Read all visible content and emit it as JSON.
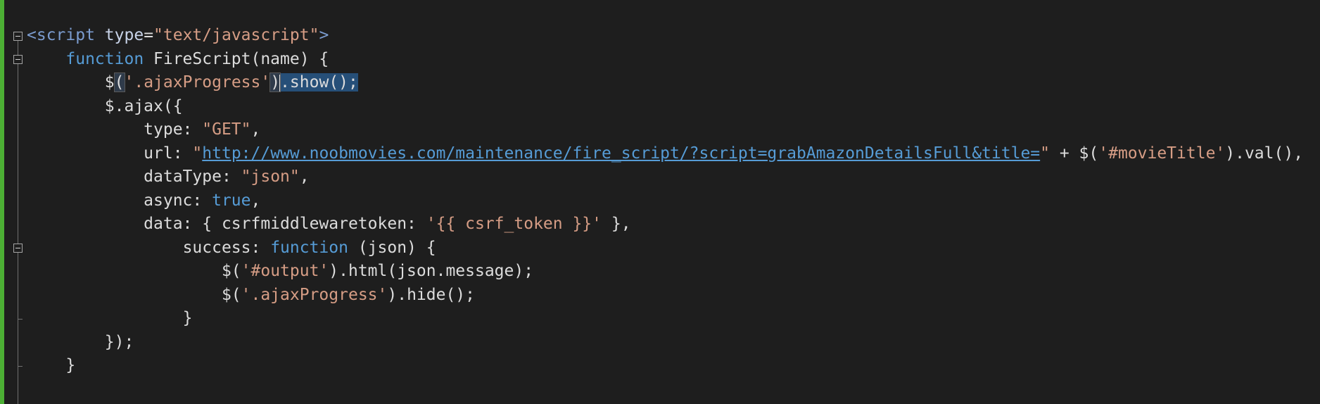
{
  "colors": {
    "background": "#1e1e1e",
    "change_bar": "#4caf34",
    "keyword": "#569cd6",
    "string": "#d69d85",
    "plain": "#dcdcdc",
    "selection": "#264f78"
  },
  "editor": {
    "lines": [
      {
        "indent": 0,
        "tokens": [
          {
            "c": "tag",
            "t": "<script"
          },
          {
            "c": "attr",
            "t": " type"
          },
          {
            "c": "plain",
            "t": "="
          },
          {
            "c": "string",
            "t": "\"text/javascript\""
          },
          {
            "c": "tag",
            "t": ">"
          }
        ]
      },
      {
        "indent": 4,
        "tokens": [
          {
            "c": "keyword",
            "t": "function"
          },
          {
            "c": "plain",
            "t": " FireScript(name) {"
          }
        ]
      },
      {
        "indent": 8,
        "tokens": [
          {
            "c": "plain",
            "t": "$"
          },
          {
            "c": "hl",
            "t": "("
          },
          {
            "c": "string",
            "t": "'.ajaxProgress'"
          },
          {
            "c": "hl",
            "t": ")"
          },
          {
            "c": "caret",
            "t": ""
          },
          {
            "c": "sel",
            "t": ".show();"
          }
        ]
      },
      {
        "indent": 8,
        "tokens": [
          {
            "c": "plain",
            "t": "$.ajax({"
          }
        ]
      },
      {
        "indent": 12,
        "tokens": [
          {
            "c": "plain",
            "t": "type: "
          },
          {
            "c": "string",
            "t": "\"GET\""
          },
          {
            "c": "plain",
            "t": ","
          }
        ]
      },
      {
        "indent": 12,
        "tokens": [
          {
            "c": "plain",
            "t": "url: "
          },
          {
            "c": "string",
            "t": "\""
          },
          {
            "c": "url",
            "t": "http://www.noobmovies.com/maintenance/fire_script/?script=grabAmazonDetailsFull&title="
          },
          {
            "c": "string",
            "t": "\""
          },
          {
            "c": "plain",
            "t": " + $("
          },
          {
            "c": "string",
            "t": "'#movieTitle'"
          },
          {
            "c": "plain",
            "t": ").val(),"
          }
        ]
      },
      {
        "indent": 12,
        "tokens": [
          {
            "c": "plain",
            "t": "dataType: "
          },
          {
            "c": "string",
            "t": "\"json\""
          },
          {
            "c": "plain",
            "t": ","
          }
        ]
      },
      {
        "indent": 12,
        "tokens": [
          {
            "c": "plain",
            "t": "async: "
          },
          {
            "c": "keyword",
            "t": "true"
          },
          {
            "c": "plain",
            "t": ","
          }
        ]
      },
      {
        "indent": 12,
        "tokens": [
          {
            "c": "plain",
            "t": "data: { csrfmiddlewaretoken: "
          },
          {
            "c": "string",
            "t": "'{{ csrf_token }}'"
          },
          {
            "c": "plain",
            "t": " },"
          }
        ]
      },
      {
        "indent": 16,
        "tokens": [
          {
            "c": "plain",
            "t": "success: "
          },
          {
            "c": "keyword",
            "t": "function"
          },
          {
            "c": "plain",
            "t": " (json) {"
          }
        ]
      },
      {
        "indent": 20,
        "tokens": [
          {
            "c": "plain",
            "t": "$("
          },
          {
            "c": "string",
            "t": "'#output'"
          },
          {
            "c": "plain",
            "t": ").html(json.message);"
          }
        ]
      },
      {
        "indent": 20,
        "tokens": [
          {
            "c": "plain",
            "t": "$("
          },
          {
            "c": "string",
            "t": "'.ajaxProgress'"
          },
          {
            "c": "plain",
            "t": ").hide();"
          }
        ]
      },
      {
        "indent": 16,
        "tokens": [
          {
            "c": "plain",
            "t": "}"
          }
        ]
      },
      {
        "indent": 8,
        "tokens": [
          {
            "c": "plain",
            "t": "});"
          }
        ]
      },
      {
        "indent": 4,
        "tokens": [
          {
            "c": "plain",
            "t": "}"
          }
        ]
      },
      {
        "indent": 0,
        "tokens": []
      }
    ]
  },
  "outline": {
    "collapse_lines": [
      0,
      1,
      9
    ],
    "block_end_lines": [
      12,
      14
    ]
  }
}
